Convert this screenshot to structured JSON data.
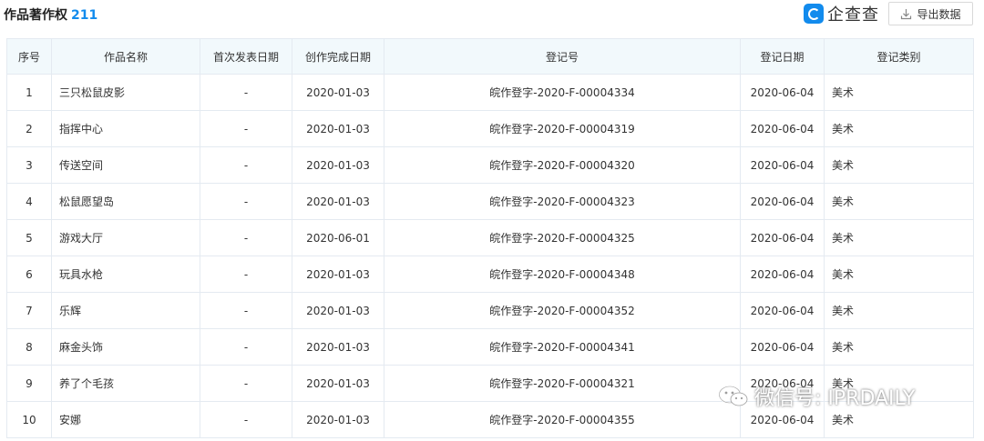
{
  "header": {
    "title": "作品著作权",
    "count": "211",
    "brand_name": "企查查",
    "export_label": "导出数据"
  },
  "table": {
    "columns": [
      "序号",
      "作品名称",
      "首次发表日期",
      "创作完成日期",
      "登记号",
      "登记日期",
      "登记类别"
    ],
    "rows": [
      [
        "1",
        "三只松鼠皮影",
        "-",
        "2020-01-03",
        "皖作登字-2020-F-00004334",
        "2020-06-04",
        "美术"
      ],
      [
        "2",
        "指挥中心",
        "-",
        "2020-01-03",
        "皖作登字-2020-F-00004319",
        "2020-06-04",
        "美术"
      ],
      [
        "3",
        "传送空间",
        "-",
        "2020-01-03",
        "皖作登字-2020-F-00004320",
        "2020-06-04",
        "美术"
      ],
      [
        "4",
        "松鼠愿望岛",
        "-",
        "2020-01-03",
        "皖作登字-2020-F-00004323",
        "2020-06-04",
        "美术"
      ],
      [
        "5",
        "游戏大厅",
        "-",
        "2020-06-01",
        "皖作登字-2020-F-00004325",
        "2020-06-04",
        "美术"
      ],
      [
        "6",
        "玩具水枪",
        "-",
        "2020-01-03",
        "皖作登字-2020-F-00004348",
        "2020-06-04",
        "美术"
      ],
      [
        "7",
        "乐辉",
        "-",
        "2020-01-03",
        "皖作登字-2020-F-00004352",
        "2020-06-04",
        "美术"
      ],
      [
        "8",
        "麻金头饰",
        "-",
        "2020-01-03",
        "皖作登字-2020-F-00004341",
        "2020-06-04",
        "美术"
      ],
      [
        "9",
        "养了个毛孩",
        "-",
        "2020-01-03",
        "皖作登字-2020-F-00004321",
        "2020-06-04",
        "美术"
      ],
      [
        "10",
        "安娜",
        "-",
        "2020-01-03",
        "皖作登字-2020-F-00004355",
        "2020-06-04",
        "美术"
      ]
    ]
  },
  "watermark": {
    "text": "微信号: IPRDAILY"
  },
  "colors": {
    "accent": "#128bed",
    "header_bg": "#f2f9fc",
    "border": "#e4eaf1"
  },
  "icons": {
    "brand": "qichacha-logo-icon",
    "export": "download-icon",
    "watermark": "wechat-icon"
  }
}
